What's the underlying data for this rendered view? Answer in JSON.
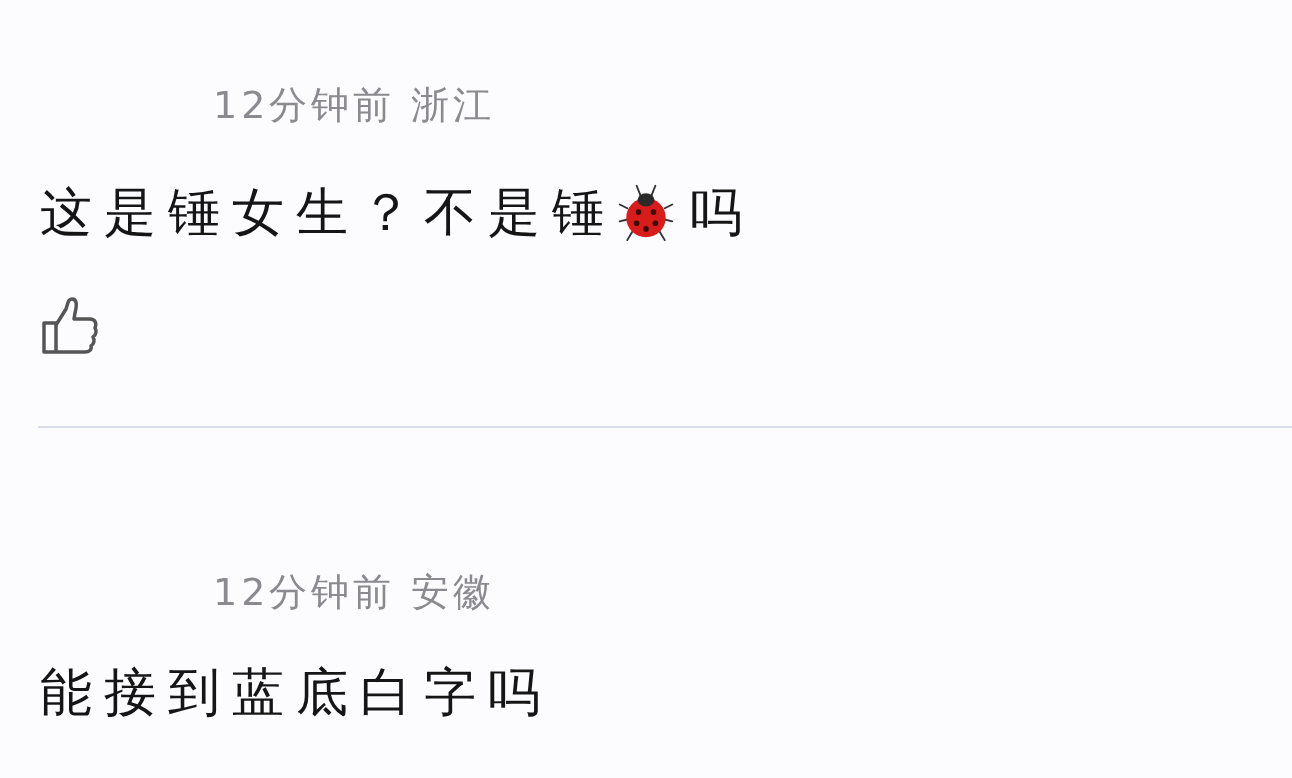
{
  "comments": [
    {
      "meta": "12分钟前 浙江",
      "content": [
        {
          "kind": "text",
          "text": "这是锤女生？不是锤"
        },
        {
          "kind": "ladybug"
        },
        {
          "kind": "text",
          "text": "吗"
        }
      ],
      "show_like": true
    },
    {
      "meta": "12分钟前 安徽",
      "content": [
        {
          "kind": "text",
          "text": "能接到蓝底白字吗"
        }
      ],
      "show_like": false
    }
  ]
}
